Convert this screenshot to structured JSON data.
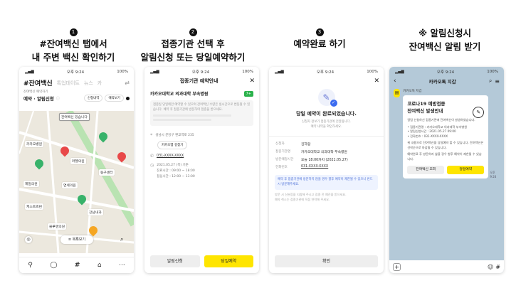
{
  "steps": [
    {
      "num": "1",
      "line1": "#잔여백신 탭에서",
      "line2": "내 주변 백신 확인하기"
    },
    {
      "num": "2",
      "line1": "접종기관 선택 후",
      "line2": "알림신청 또는 당일예약하기"
    },
    {
      "num": "3",
      "line1": "예약완료 하기",
      "line2": ""
    },
    {
      "num": "※",
      "line1": "알림신청시",
      "line2": "잔여백신 알림 받기"
    }
  ],
  "status": {
    "time": "오후 9:24",
    "battery": "100%"
  },
  "phone1": {
    "tabs": [
      "#잔여백신",
      "톡업데이트",
      "뉴스",
      "카"
    ],
    "subtitle": "잔여백신 예약하기",
    "mode": "예약 · 알림신청",
    "chips": [
      "신청내역",
      "예약보기"
    ],
    "map_bubble": "잔여백신 있습니다",
    "map_labels": [
      "카카오병원",
      "라헬의원",
      "동구센터",
      "제일의원",
      "연세의원",
      "케스트흐린",
      "강남내과",
      "블루앤의원"
    ],
    "list_button": "목록보기",
    "nav_icons": [
      "person-icon",
      "chat-icon",
      "hash-icon",
      "bag-icon",
      "more-icon"
    ]
  },
  "phone2": {
    "title": "접종기관 예약안내",
    "hospital": "카카오대학교 의과대학 부속병원",
    "badge": "7+",
    "notice": "접종일 당일에만 예약할 수 있으며 잔여백신 수량은 실시간으로 변동될 수 있습니다. 예약 후 접종기관에 방문하여 접종을 받으세요.",
    "address": "성남시 분당구 판교역로 235",
    "route_button": "카카오맵 길찾기",
    "phone": "031-XXXX-XXXX",
    "hours_date": "2021.05.27 (목) 기준",
    "hours_weekday": "진료시간 : 09:00 ~ 18:00",
    "hours_lunch": "점심시간 : 12:00 ~ 13:00",
    "btn_alarm": "알림신청",
    "btn_reserve": "당일예약"
  },
  "phone3": {
    "headline": "당일 예약이 완료되었습니다.",
    "sub1": "신청자 정보가 접종기관에 전달됩니다.",
    "sub2": "예약 내역을 확인하세요.",
    "rows": [
      {
        "k": "신청자",
        "v": "김하람"
      },
      {
        "k": "접종기관명",
        "v": "카카오대학교 의과대학 부속병원"
      },
      {
        "k": "방문예정시간",
        "v": "오늘 18:00까지 (2021.05.27)"
      },
      {
        "k": "전화번호",
        "v": "031-XXXX-XXXX"
      }
    ],
    "highlight": "예약 후 접종기관에 방문하지 않을 경우 향후 예약이 제한될 수 있으니 반드시 방문해주세요.",
    "note1": "방문 시 신분증을 지참해 주시고 접종 전 예진을 받으세요.",
    "note2": "예약 취소는 접종기관에 직접 연락해 주세요.",
    "confirm": "확인"
  },
  "phone4": {
    "title": "카카오톡 지갑",
    "sender": "카카오톡 지갑",
    "msg_line1": "코로나19 예방접종",
    "msg_line2": "잔여백신 발생안내",
    "body1": "알림 신청하신 접종기관에 잔여백신이 발생하였습니다.",
    "detail1": "• 접종기관명 : 카카오대학교 의과대학 부속병원",
    "detail2": "• 알림신청시간 : 2021.05.27 09:00",
    "detail3": "• 전화번호 : 031-XXXX-XXXX",
    "body2": "위 내용으로 잔여백신을 당일예약 할 수 있습니다. 잔여백신은 선착순으로 마감될 수 있습니다.",
    "body3": "예약완료 후 방문하지 않을 경우 향후 예약이 제한될 수 있습니다.",
    "btn_check": "잔여백신 조회",
    "btn_reserve": "당일예약",
    "time": "오후 9:24"
  }
}
